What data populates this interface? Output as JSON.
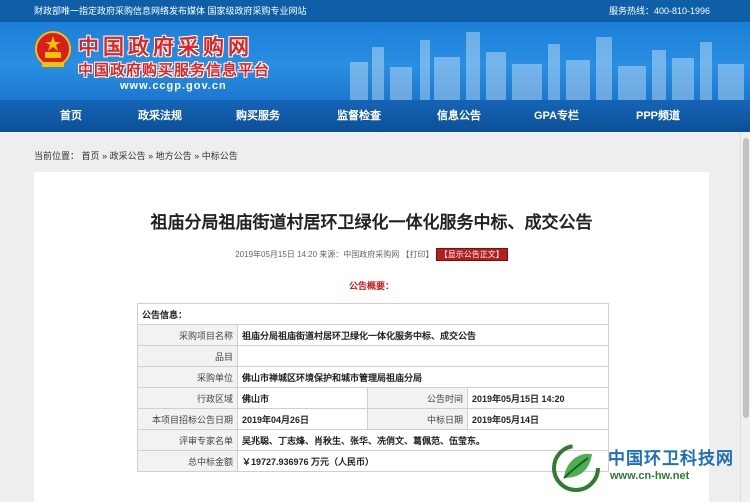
{
  "topbar": {
    "left": "财政部唯一指定政府采购信息网络发布媒体  国家级政府采购专业网站",
    "right": "服务热线：400-810-1996"
  },
  "banner": {
    "title": "中国政府采购网",
    "subtitle": "中国政府购买服务信息平台",
    "url": "www.ccgp.gov.cn"
  },
  "nav": [
    {
      "label": "首页"
    },
    {
      "label": "政采法规"
    },
    {
      "label": "购买服务"
    },
    {
      "label": "监督检查"
    },
    {
      "label": "信息公告"
    },
    {
      "label": "GPA专栏"
    },
    {
      "label": "PPP频道"
    }
  ],
  "breadcrumb": {
    "prefix": "当前位置：",
    "items": [
      "首页",
      "政采公告",
      "地方公告",
      "中标公告"
    ],
    "sep": "»"
  },
  "article": {
    "title": "祖庙分局祖庙街道村居环卫绿化一体化服务中标、成交公告",
    "meta_date": "2019年05月15日 14:20 来源：中国政府采购网 【打印】",
    "meta_button": "【显示公告正文】",
    "summary_heading": "公告概要："
  },
  "table": {
    "section_header": "公告信息：",
    "rows": [
      {
        "label": "采购项目名称",
        "value": "祖庙分局祖庙街道村居环卫绿化一体化服务中标、成交公告"
      },
      {
        "label": "品目",
        "value": ""
      },
      {
        "label": "采购单位",
        "value": "佛山市禅城区环境保护和城市管理局祖庙分局"
      },
      {
        "label": "行政区域",
        "value": "佛山市",
        "label2": "公告时间",
        "value2": "2019年05月15日 14:20"
      },
      {
        "label": "本项目招标公告日期",
        "value": "2019年04月26日",
        "label2": "中标日期",
        "value2": "2019年05月14日"
      },
      {
        "label": "评审专家名单",
        "value": "吴兆聪、丁志烽、肖秋生、张华、冼俏文、葛佩范、伍莹东。"
      },
      {
        "label": "总中标金额",
        "value": "￥19727.936976 万元（人民币）"
      }
    ]
  },
  "watermark": {
    "title": "中国环卫科技网",
    "url": "www.cn-hw.net"
  },
  "colors": {
    "header_blue": "#0e5fa8",
    "banner_blue": "#2a8fe3",
    "logo_red": "#e02323",
    "alert_red": "#cc1a1a"
  }
}
